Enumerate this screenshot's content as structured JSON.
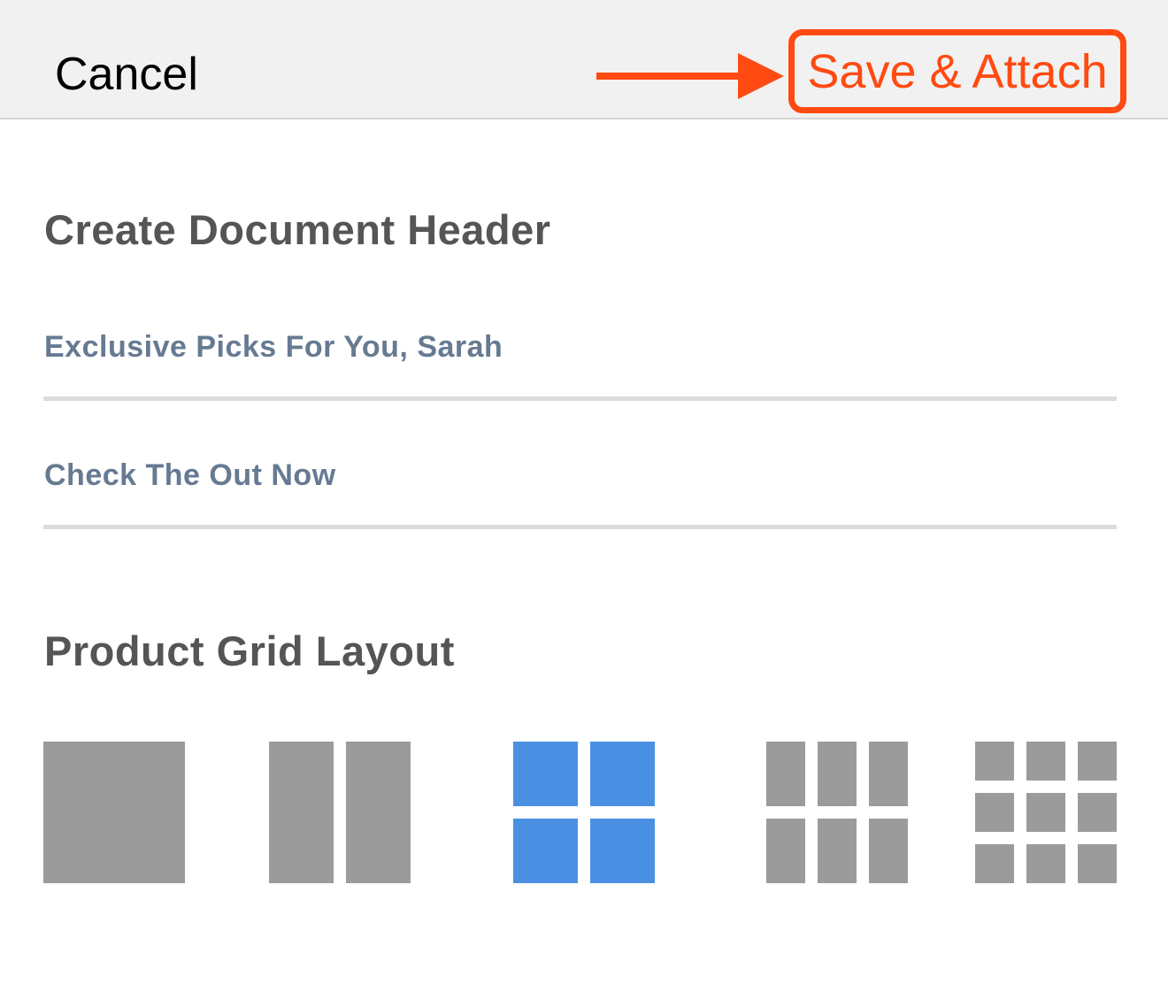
{
  "toolbar": {
    "cancel_label": "Cancel",
    "save_label": "Save & Attach",
    "accent_color": "#ff4a12"
  },
  "header_section": {
    "title": "Create Document Header",
    "fields": [
      {
        "value": "Exclusive Picks For You, Sarah"
      },
      {
        "value": "Check The Out Now"
      }
    ]
  },
  "grid_section": {
    "title": "Product Grid Layout",
    "options": [
      {
        "name": "1x1",
        "selected": false
      },
      {
        "name": "2 columns",
        "selected": false
      },
      {
        "name": "2x2",
        "selected": true
      },
      {
        "name": "3x2",
        "selected": false
      },
      {
        "name": "3x3",
        "selected": false
      }
    ],
    "selected_color": "#4a90e2",
    "unselected_color": "#9b9b9b"
  }
}
